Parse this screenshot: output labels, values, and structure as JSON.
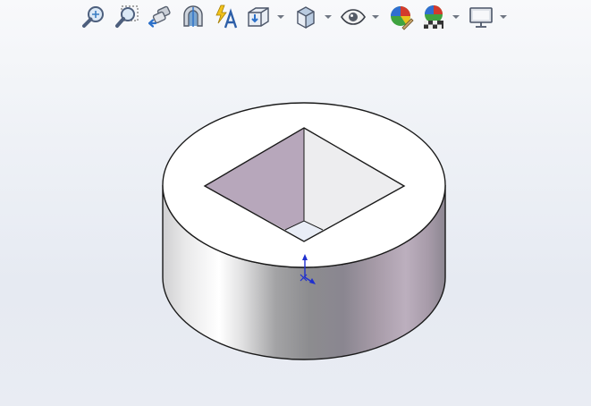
{
  "toolbar": {
    "items": [
      {
        "icon": "zoom-to-fit-icon",
        "has_dropdown": false
      },
      {
        "icon": "zoom-to-area-icon",
        "has_dropdown": false
      },
      {
        "icon": "previous-view-icon",
        "has_dropdown": false
      },
      {
        "icon": "section-view-icon",
        "has_dropdown": false
      },
      {
        "icon": "dynamic-annotation-views-icon",
        "has_dropdown": false
      },
      {
        "icon": "view-orientation-icon",
        "has_dropdown": true
      },
      {
        "icon": "display-style-icon",
        "has_dropdown": true
      },
      {
        "icon": "hide-show-items-icon",
        "has_dropdown": true
      },
      {
        "icon": "edit-appearance-icon",
        "has_dropdown": false
      },
      {
        "icon": "apply-scene-icon",
        "has_dropdown": true
      },
      {
        "icon": "view-settings-icon",
        "has_dropdown": true
      }
    ]
  },
  "colors": {
    "background_top": "#f8f9fb",
    "background_bottom": "#e6eaf2",
    "model_edge": "#1a1a1a",
    "top_face": "#ffffff",
    "pocket_left_wall": "#b7a7bb",
    "pocket_right_wall": "#ededef",
    "pocket_floor": "#e9edf6",
    "triad_axis": "#1f2fcf"
  }
}
